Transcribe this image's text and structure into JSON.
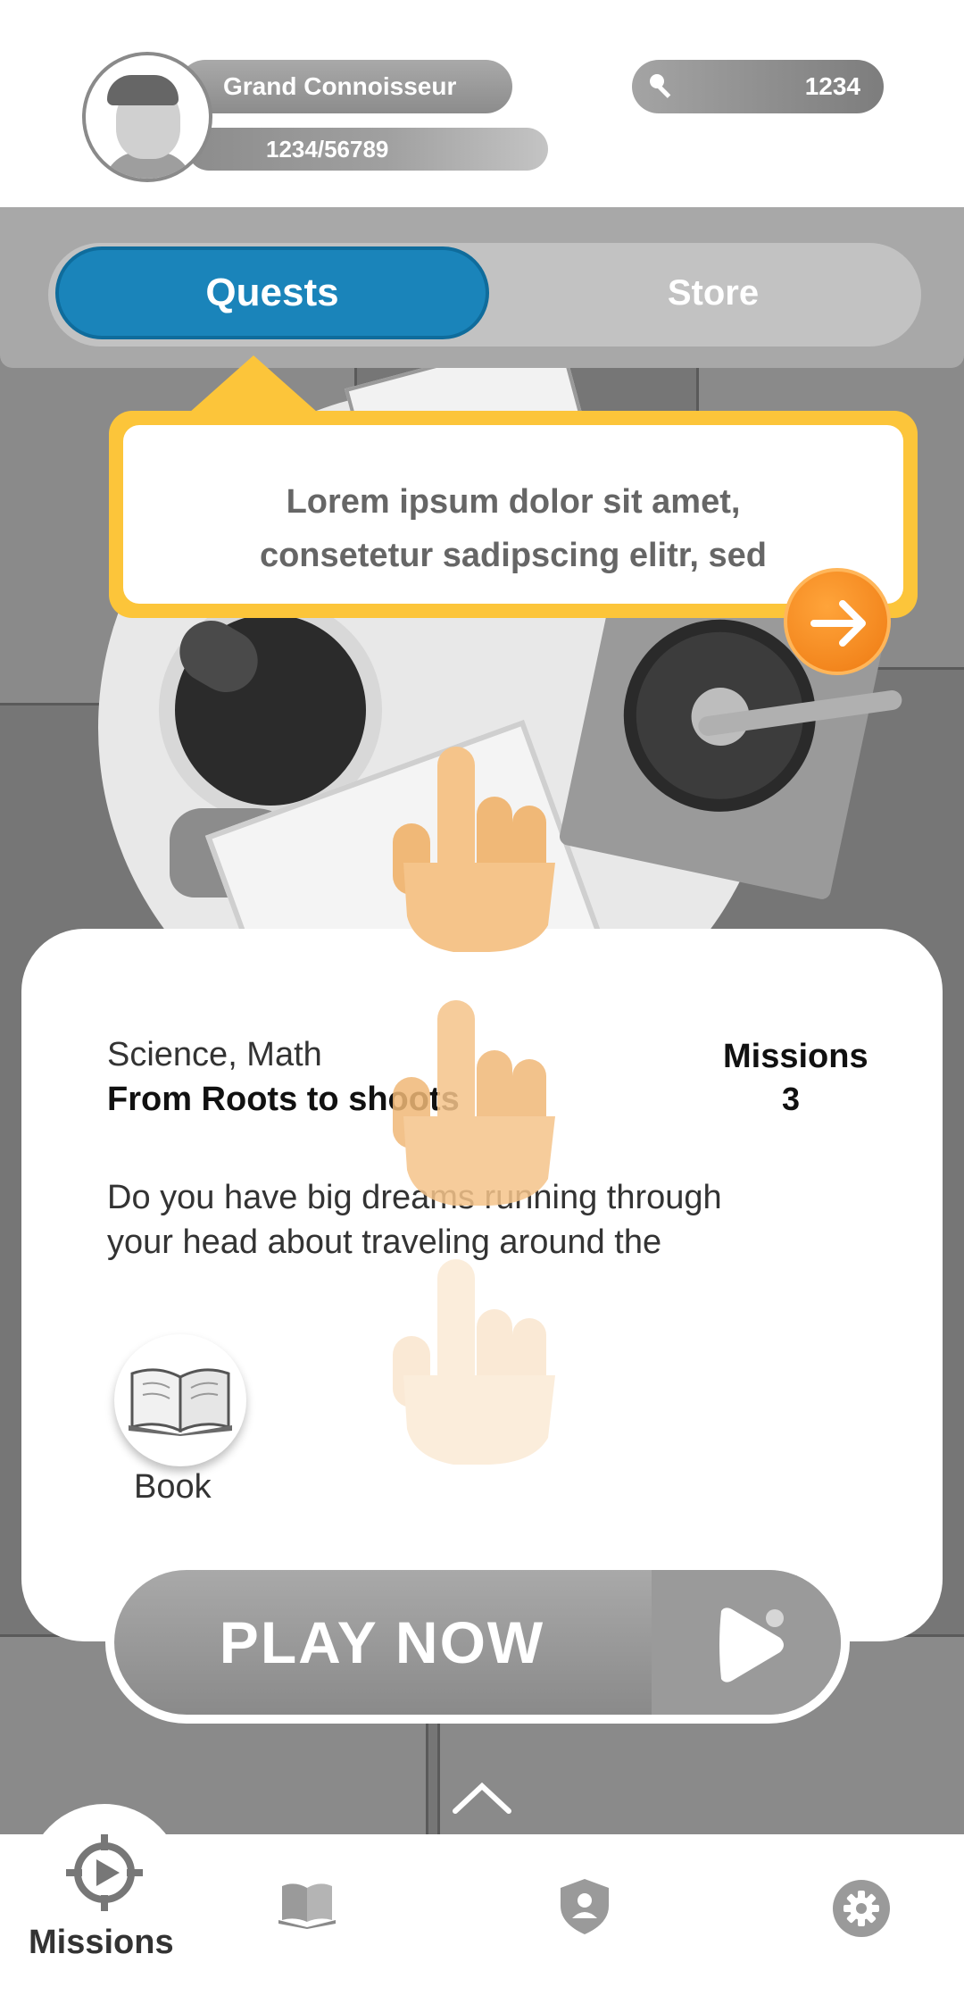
{
  "header": {
    "rank_title": "Grand Connoisseur",
    "xp_progress": "1234/56789",
    "xp_fraction": 0.022,
    "key_count": "1234"
  },
  "tabs": [
    {
      "label": "Quests",
      "active": true
    },
    {
      "label": "Store",
      "active": false
    }
  ],
  "tooltip": {
    "line1": "Lorem ipsum dolor sit amet,",
    "line2": "consetetur sadipscing elitr, sed"
  },
  "quest": {
    "subjects": "Science, Math",
    "title": "From Roots to shoots",
    "missions_label": "Missions",
    "missions_count": "3",
    "description_line1": "Do you have big dreams running through",
    "description_line2": "your head about traveling around the",
    "resource_label": "Book",
    "resource_icon": "open-book-icon"
  },
  "play_button": {
    "label": "PLAY NOW"
  },
  "bottom_nav": {
    "active_label": "Missions",
    "items": [
      "missions-compass-icon",
      "book-icon",
      "profile-shield-icon",
      "settings-gear-icon"
    ]
  },
  "colors": {
    "accent_blue": "#1a84ba",
    "tooltip_yellow": "#fcc53a",
    "next_orange": "#ee7a12",
    "finger_skin": "#f5c48a"
  }
}
